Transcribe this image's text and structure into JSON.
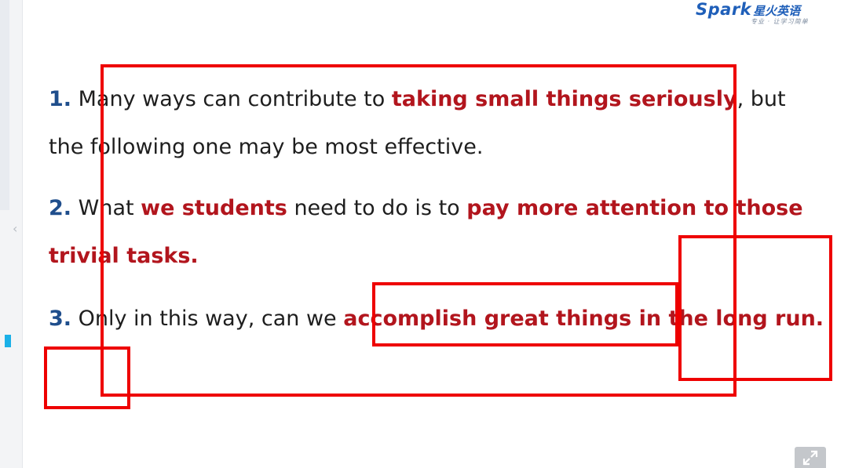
{
  "logo": {
    "latin": "Spark",
    "cjk": "星火英语",
    "tagline": "专业 · 让学习简单"
  },
  "sentences": [
    {
      "number": "1.",
      "parts": [
        {
          "text": " Many ways can contribute to ",
          "highlight": false
        },
        {
          "text": "taking small things seriously",
          "highlight": true
        },
        {
          "text": ", but the following one may be most effective.",
          "highlight": false
        }
      ]
    },
    {
      "number": "2.",
      "parts": [
        {
          "text": " What ",
          "highlight": false
        },
        {
          "text": "we students",
          "highlight": true
        },
        {
          "text": " need to do is to ",
          "highlight": false
        },
        {
          "text": "pay more attention to those trivial tasks.",
          "highlight": true
        }
      ]
    },
    {
      "number": "3.",
      "parts": [
        {
          "text": " Only in this way, can we ",
          "highlight": false
        },
        {
          "text": "accomplish great things in the long run.",
          "highlight": true
        }
      ]
    }
  ],
  "icons": {
    "sidebar_collapse": "chevron-left-icon",
    "expand": "expand-arrows-icon"
  },
  "colors": {
    "number": "#1f4e8c",
    "highlight": "#b2151d",
    "annotation": "#ee0000",
    "logo": "#1f5fb9"
  }
}
